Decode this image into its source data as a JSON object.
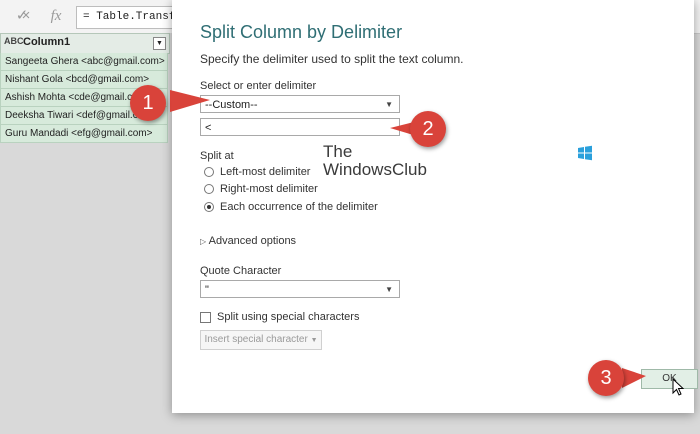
{
  "formula_bar": {
    "cancel_icon": "×",
    "confirm_icon": "✓",
    "fx_label": "fx",
    "formula": "= Table.Transfor"
  },
  "grid": {
    "type_badge": "ABC",
    "column_header": "Column1",
    "rows": [
      "Sangeeta Ghera <abc@gmail.com>",
      "Nishant Gola <bcd@gmail.com>",
      "Ashish Mohta <cde@gmail.com>",
      "Deeksha Tiwari <def@gmail.com>",
      "Guru Mandadi <efg@gmail.com>"
    ]
  },
  "dialog": {
    "title": "Split Column by Delimiter",
    "description": "Specify the delimiter used to split the text column.",
    "delimiter_label": "Select or enter delimiter",
    "delimiter_value": "--Custom--",
    "custom_value": "<",
    "split_at_label": "Split at",
    "split_options": [
      "Left-most delimiter",
      "Right-most delimiter",
      "Each occurrence of the delimiter"
    ],
    "selected_split": 2,
    "advanced_label": "Advanced options",
    "quote_label": "Quote Character",
    "quote_value": "\"",
    "special_chars_label": "Split using special characters",
    "insert_special_label": "Insert special character",
    "ok_label": "OK"
  },
  "logo": {
    "line1": "The",
    "line2": "WindowsClub"
  },
  "callouts": [
    "1",
    "2",
    "3"
  ],
  "colors": {
    "title": "#2f6e74",
    "callout": "#d9433a",
    "row_fill": "#d7eadb"
  }
}
